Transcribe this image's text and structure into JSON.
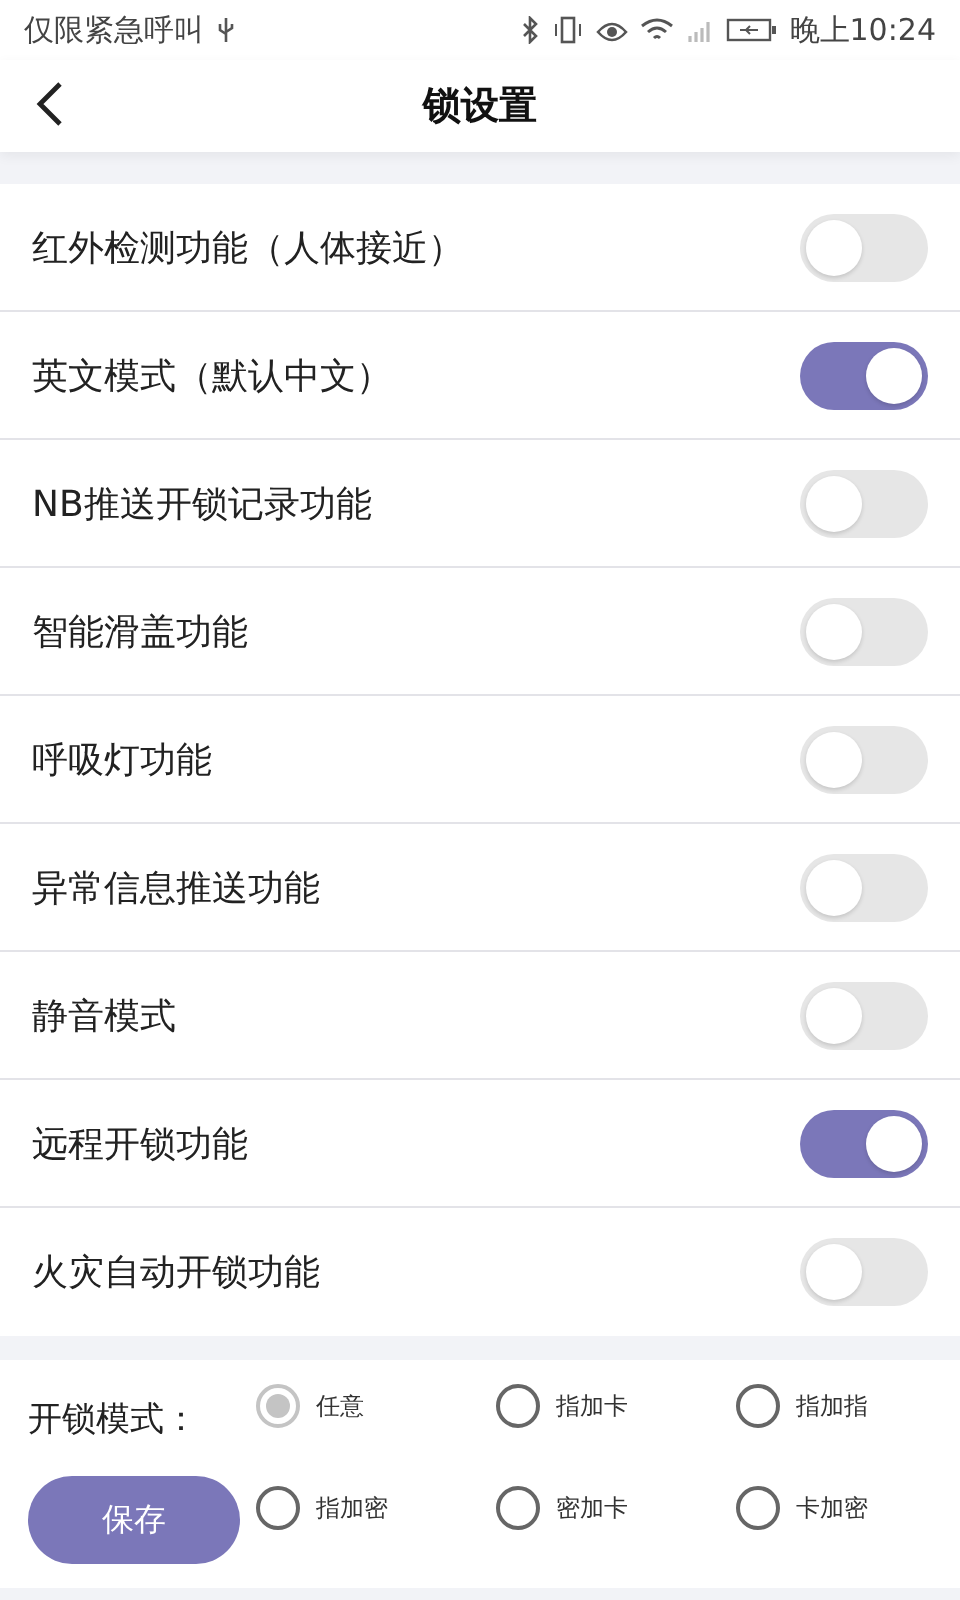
{
  "status_bar": {
    "carrier": "仅限紧急呼叫",
    "time": "晚上10:24"
  },
  "header": {
    "title": "锁设置"
  },
  "settings": [
    {
      "label": "红外检测功能（人体接近）",
      "on": false
    },
    {
      "label": "英文模式（默认中文）",
      "on": true
    },
    {
      "label": "NB推送开锁记录功能",
      "on": false
    },
    {
      "label": "智能滑盖功能",
      "on": false
    },
    {
      "label": "呼吸灯功能",
      "on": false
    },
    {
      "label": "异常信息推送功能",
      "on": false
    },
    {
      "label": "静音模式",
      "on": false
    },
    {
      "label": "远程开锁功能",
      "on": true
    },
    {
      "label": "火灾自动开锁功能",
      "on": false
    }
  ],
  "unlock_mode": {
    "label": "开锁模式：",
    "options": [
      {
        "label": "任意",
        "selected": true
      },
      {
        "label": "指加卡",
        "selected": false
      },
      {
        "label": "指加指",
        "selected": false
      },
      {
        "label": "指加密",
        "selected": false
      },
      {
        "label": "密加卡",
        "selected": false
      },
      {
        "label": "卡加密",
        "selected": false
      }
    ]
  },
  "save_button": "保存"
}
